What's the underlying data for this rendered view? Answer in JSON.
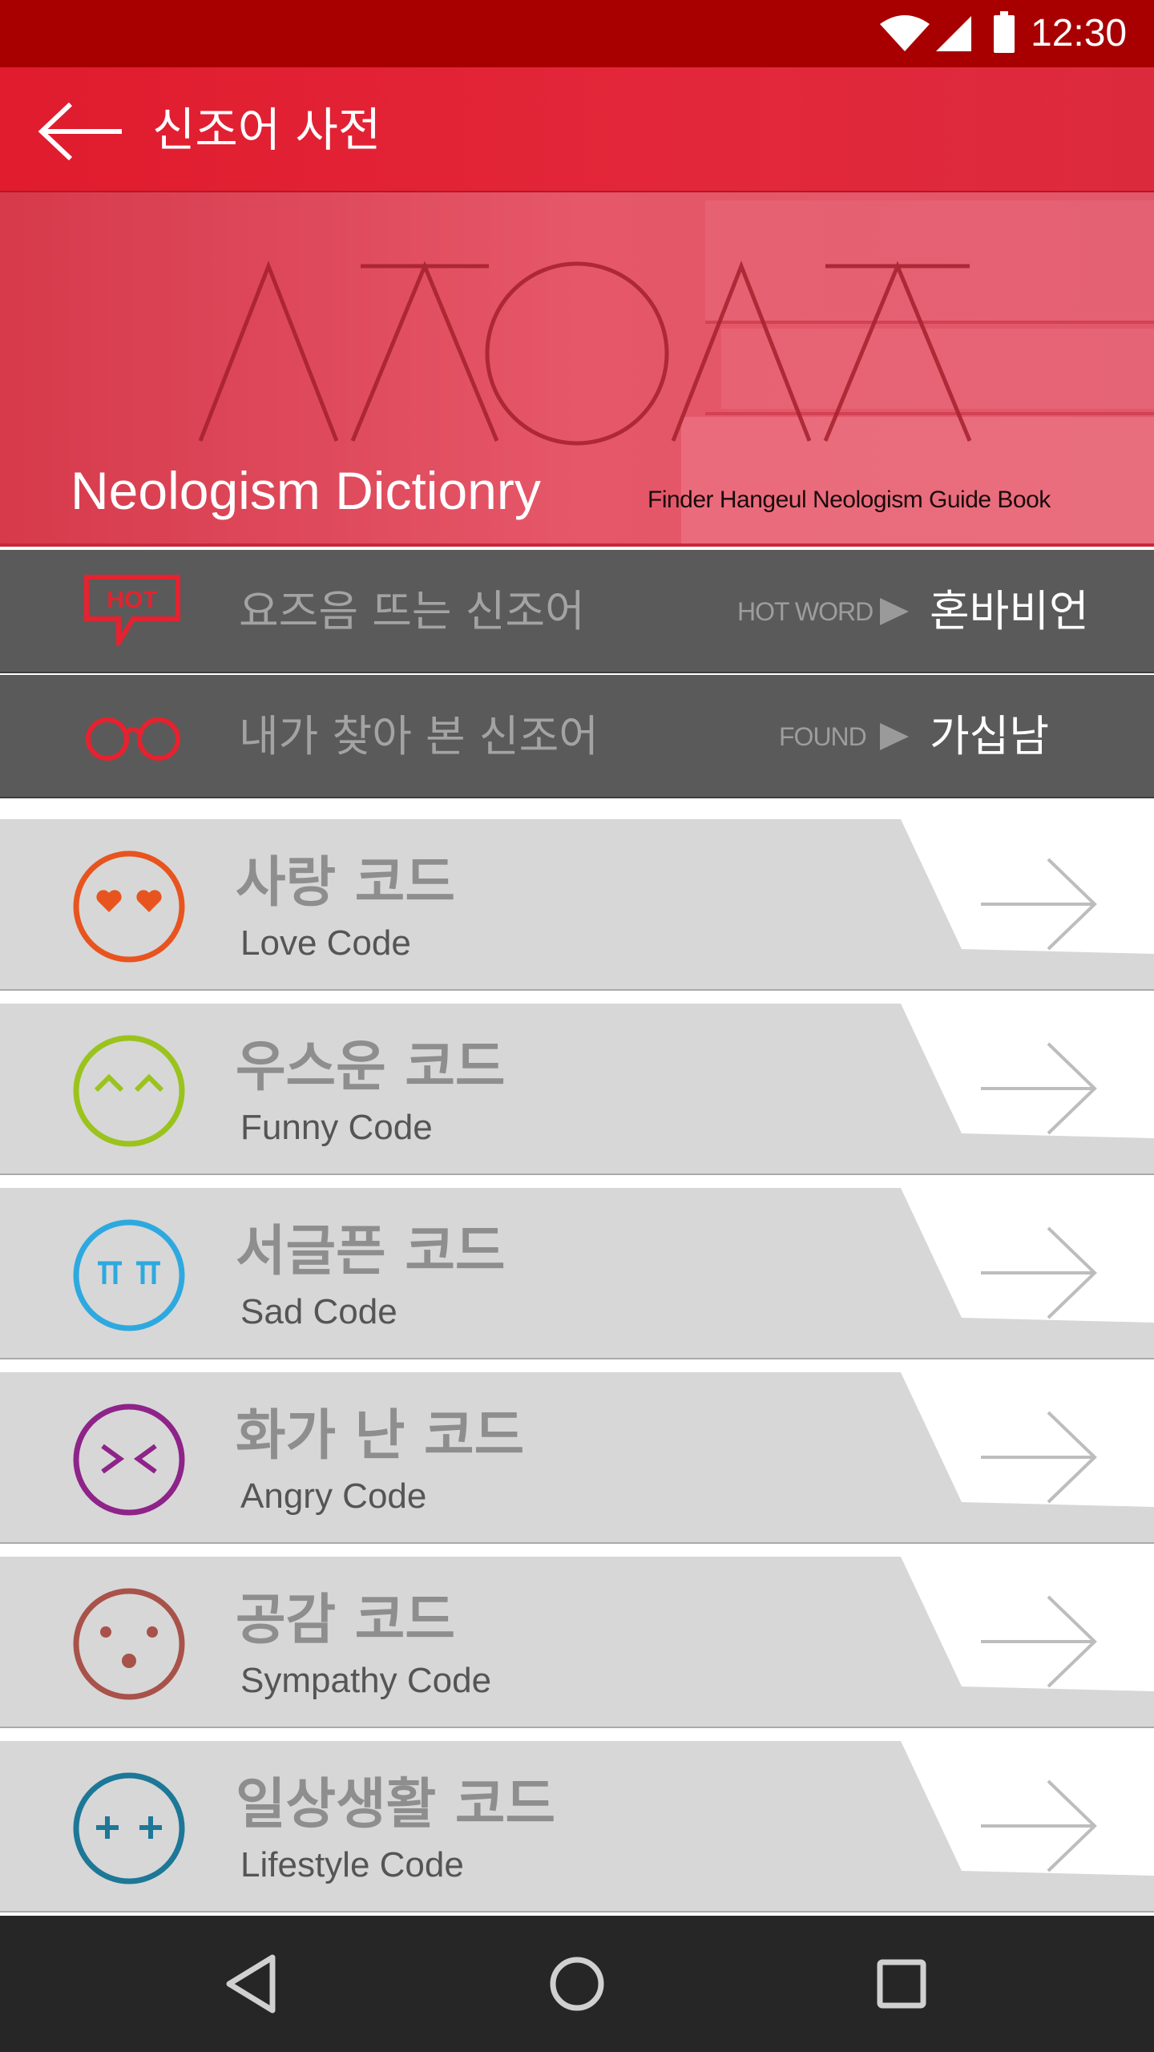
{
  "status_bar": {
    "time": "12:30",
    "icons": [
      "wifi-icon",
      "cell-signal-icon",
      "battery-icon"
    ]
  },
  "toolbar": {
    "title": "신조어 사전",
    "back_icon": "arrow-left-icon"
  },
  "banner": {
    "logo_text": "ㅅㅈㅇㅅㅈ",
    "title": "Neologism Dictionry",
    "subtitle": "Finder Hangeul Neologism Guide Book"
  },
  "hot_row": {
    "label": "요즈음 뜨는 신조어",
    "tag": "HOT WORD",
    "value": "혼바비언",
    "icon": "hot-speech-bubble-icon"
  },
  "found_row": {
    "label": "내가 찾아 본 신조어",
    "tag": "FOUND",
    "value": "가십남",
    "icon": "glasses-icon"
  },
  "codes": [
    {
      "ko": "사랑 코드",
      "en": "Love Code",
      "icon": "heart-eyes-face-icon",
      "color": "#e8541f"
    },
    {
      "ko": "우스운 코드",
      "en": "Funny Code",
      "icon": "smiling-face-icon",
      "color": "#9ac31c"
    },
    {
      "ko": "서글픈 코드",
      "en": "Sad Code",
      "icon": "crying-face-icon",
      "color": "#2ea9e0"
    },
    {
      "ko": "화가 난 코드",
      "en": "Angry Code",
      "icon": "angry-face-icon",
      "color": "#8e2389"
    },
    {
      "ko": "공감 코드",
      "en": "Sympathy Code",
      "icon": "surprised-face-icon",
      "color": "#a8524a"
    },
    {
      "ko": "일상생활 코드",
      "en": "Lifestyle Code",
      "icon": "plus-eyes-face-icon",
      "color": "#1d7797"
    }
  ],
  "colors": {
    "status_bar": "#a80000",
    "toolbar": "#e3273a",
    "dark_row": "#5a5a5a",
    "card_panel": "#d7d7d7",
    "nav_bar": "#262626"
  },
  "nav": {
    "icons": [
      "back-triangle-icon",
      "home-circle-icon",
      "recents-square-icon"
    ]
  }
}
